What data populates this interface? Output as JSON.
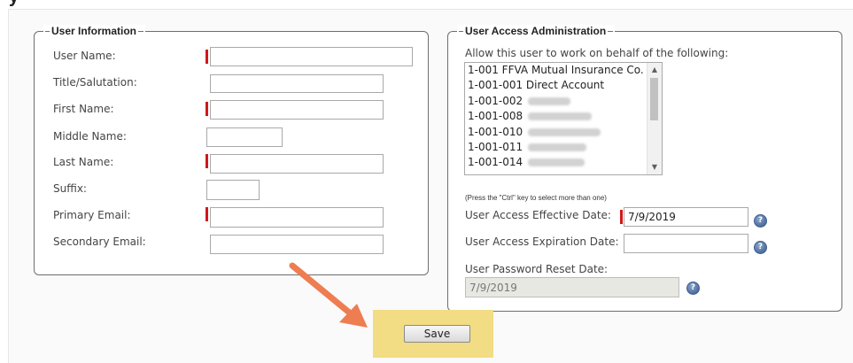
{
  "page": {
    "title": "y"
  },
  "user_info": {
    "legend": "User Information",
    "fields": [
      {
        "label": "User Name:",
        "value": "",
        "required": true
      },
      {
        "label": "Title/Salutation:",
        "value": "",
        "required": false
      },
      {
        "label": "First Name:",
        "value": "",
        "required": true
      },
      {
        "label": "Middle Name:",
        "value": "",
        "required": false
      },
      {
        "label": "Last Name:",
        "value": "",
        "required": true
      },
      {
        "label": "Suffix:",
        "value": "",
        "required": false
      },
      {
        "label": "Primary Email:",
        "value": "",
        "required": true
      },
      {
        "label": "Secondary Email:",
        "value": "",
        "required": false
      }
    ]
  },
  "access_admin": {
    "legend": "User Access Administration",
    "allow_label": "Allow this user to work on behalf of the following:",
    "accounts": [
      "1-001 FFVA Mutual Insurance Co.",
      "1-001-001 Direct Account",
      "1-001-002",
      "1-001-008",
      "1-001-010",
      "1-001-011",
      "1-001-014"
    ],
    "hint": "(Press the \"Ctrl\" key to select more than one)",
    "effective_label": "User Access Effective Date:",
    "effective_value": "7/9/2019",
    "expiration_label": "User Access Expiration Date:",
    "expiration_value": "",
    "reset_label": "User Password Reset Date:",
    "reset_value": "7/9/2019",
    "help_glyph": "?"
  },
  "actions": {
    "save_label": "Save"
  },
  "colors": {
    "required": "#d01818",
    "highlight": "#f2dc84",
    "arrow": "#ee7d52"
  }
}
